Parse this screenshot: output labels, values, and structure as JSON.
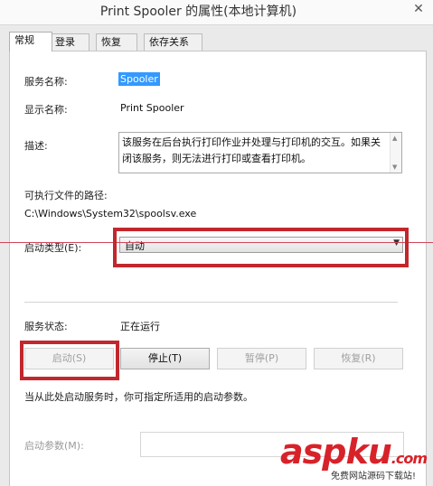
{
  "window": {
    "title": "Print Spooler 的属性(本地计算机)",
    "close_glyph": "✕"
  },
  "tabs": [
    {
      "label": "常规",
      "active": true
    },
    {
      "label": "登录",
      "active": false
    },
    {
      "label": "恢复",
      "active": false
    },
    {
      "label": "依存关系",
      "active": false
    }
  ],
  "general": {
    "service_name_label": "服务名称:",
    "service_name_value": "Spooler",
    "display_name_label": "显示名称:",
    "display_name_value": "Print Spooler",
    "description_label": "描述:",
    "description_value": "该服务在后台执行打印作业并处理与打印机的交互。如果关闭该服务，则无法进行打印或查看打印机。",
    "exe_path_label": "可执行文件的路径:",
    "exe_path_value": "C:\\Windows\\System32\\spoolsv.exe",
    "startup_type_label": "启动类型(E):",
    "startup_type_value": "自动",
    "service_status_label": "服务状态:",
    "service_status_value": "正在运行",
    "buttons": {
      "start": "启动(S)",
      "stop": "停止(T)",
      "pause": "暂停(P)",
      "resume": "恢复(R)"
    },
    "hint": "当从此处启动服务时，你可指定所适用的启动参数。",
    "start_params_label": "启动参数(M):",
    "start_params_value": ""
  },
  "watermark": {
    "logo_asp": "asp",
    "logo_ku": "ku",
    "logo_suffix": ".com",
    "subtitle": "免费网站源码下载站!"
  },
  "colors": {
    "highlight_box": "#c1272d",
    "selection": "#3399ff"
  }
}
